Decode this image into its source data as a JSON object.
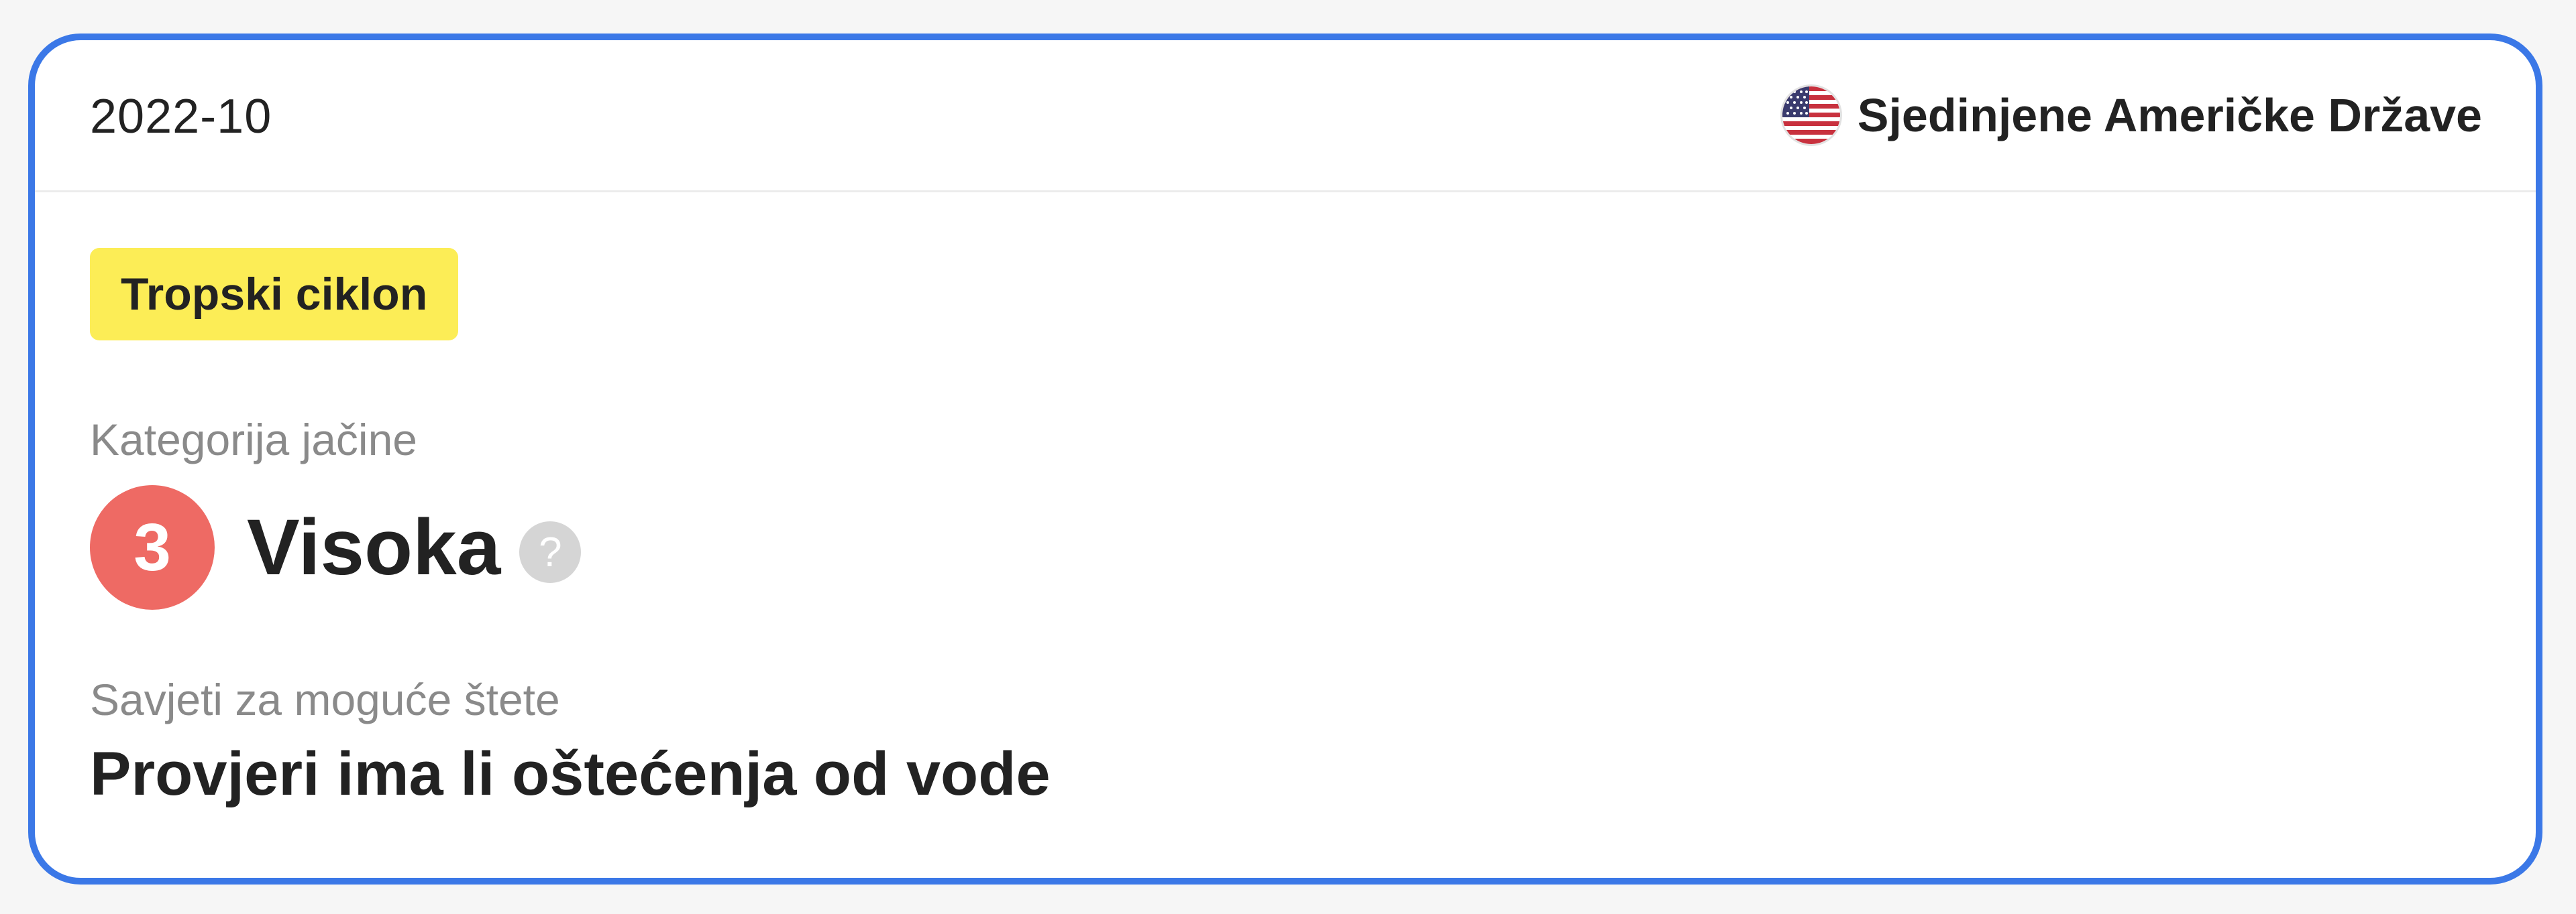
{
  "card": {
    "date": "2022-10",
    "country": {
      "name": "Sjedinjene Američke Države",
      "flag_icon": "us-flag-icon"
    },
    "event_type": "Tropski ciklon",
    "severity": {
      "label": "Kategorija jačine",
      "level": "3",
      "text": "Visoka",
      "help_glyph": "?"
    },
    "advice": {
      "label": "Savjeti za moguće štete",
      "text": "Provjeri ima li oštećenja od vode"
    }
  },
  "colors": {
    "card_border": "#3b78e7",
    "badge_background": "#fced56",
    "severity_circle": "#ee6a64",
    "help_icon_background": "#d5d5d5"
  }
}
